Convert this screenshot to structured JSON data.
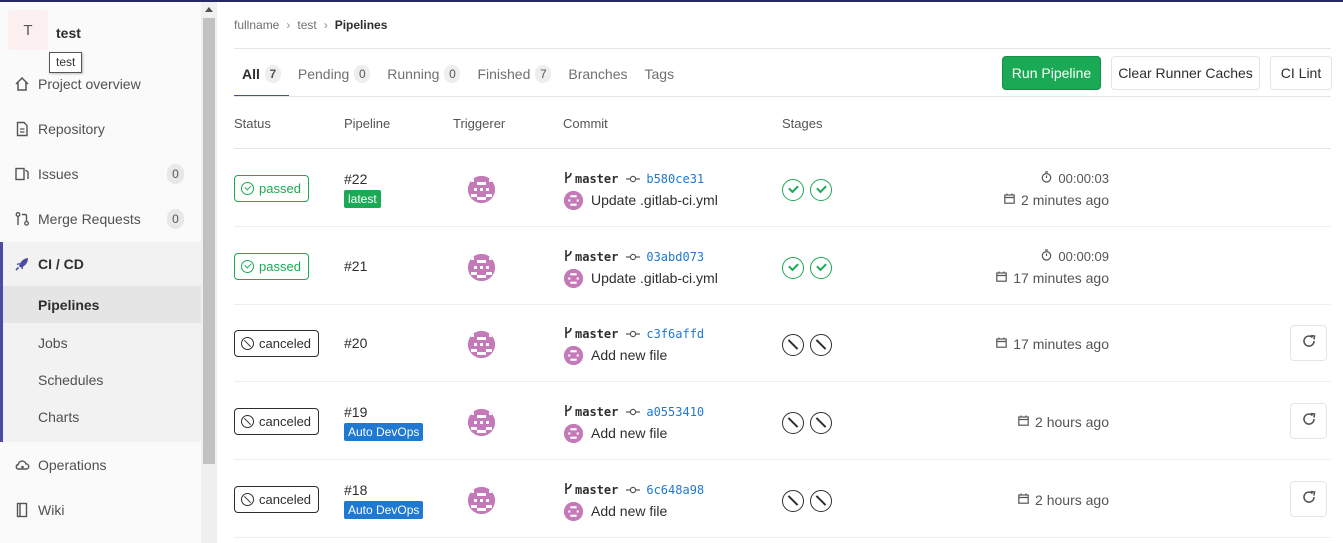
{
  "project": {
    "avatar_letter": "T",
    "name": "test",
    "tooltip": "test"
  },
  "sidebar": {
    "items": [
      {
        "label": "Project overview",
        "icon": "home-icon"
      },
      {
        "label": "Repository",
        "icon": "doc-icon"
      },
      {
        "label": "Issues",
        "icon": "issues-icon",
        "count": "0"
      },
      {
        "label": "Merge Requests",
        "icon": "merge-request-icon",
        "count": "0"
      },
      {
        "label": "CI / CD",
        "icon": "rocket-icon"
      },
      {
        "label": "Operations",
        "icon": "cloud-gear-icon"
      },
      {
        "label": "Wiki",
        "icon": "book-icon"
      }
    ],
    "cicd_sub": [
      "Pipelines",
      "Jobs",
      "Schedules",
      "Charts"
    ]
  },
  "breadcrumb": [
    "fullname",
    "test",
    "Pipelines"
  ],
  "tabs": [
    {
      "label": "All",
      "count": "7"
    },
    {
      "label": "Pending",
      "count": "0"
    },
    {
      "label": "Running",
      "count": "0"
    },
    {
      "label": "Finished",
      "count": "7"
    },
    {
      "label": "Branches"
    },
    {
      "label": "Tags"
    }
  ],
  "buttons": {
    "run": "Run Pipeline",
    "clear": "Clear Runner Caches",
    "lint": "CI Lint"
  },
  "columns": [
    "Status",
    "Pipeline",
    "Triggerer",
    "Commit",
    "Stages"
  ],
  "colors": {
    "success": "#1aaa55",
    "canceled": "#2e2e2e",
    "link": "#1f78d1",
    "accent": "#4b4ba3"
  },
  "pipelines": [
    {
      "status": "passed",
      "id": "#22",
      "label": "latest",
      "branch": "master",
      "sha": "b580ce31",
      "message": "Update .gitlab-ci.yml",
      "stages": [
        "success",
        "success"
      ],
      "duration": "00:00:03",
      "finished": "2 minutes ago",
      "retry": false
    },
    {
      "status": "passed",
      "id": "#21",
      "label": "",
      "branch": "master",
      "sha": "03abd073",
      "message": "Update .gitlab-ci.yml",
      "stages": [
        "success",
        "success"
      ],
      "duration": "00:00:09",
      "finished": "17 minutes ago",
      "retry": false
    },
    {
      "status": "canceled",
      "id": "#20",
      "label": "",
      "branch": "master",
      "sha": "c3f6affd",
      "message": "Add new file",
      "stages": [
        "canceled",
        "canceled"
      ],
      "duration": "",
      "finished": "17 minutes ago",
      "retry": true
    },
    {
      "status": "canceled",
      "id": "#19",
      "label": "Auto DevOps",
      "branch": "master",
      "sha": "a0553410",
      "message": "Add new file",
      "stages": [
        "canceled",
        "canceled"
      ],
      "duration": "",
      "finished": "2 hours ago",
      "retry": true
    },
    {
      "status": "canceled",
      "id": "#18",
      "label": "Auto DevOps",
      "branch": "master",
      "sha": "6c648a98",
      "message": "Add new file",
      "stages": [
        "canceled",
        "canceled"
      ],
      "duration": "",
      "finished": "2 hours ago",
      "retry": true
    }
  ]
}
